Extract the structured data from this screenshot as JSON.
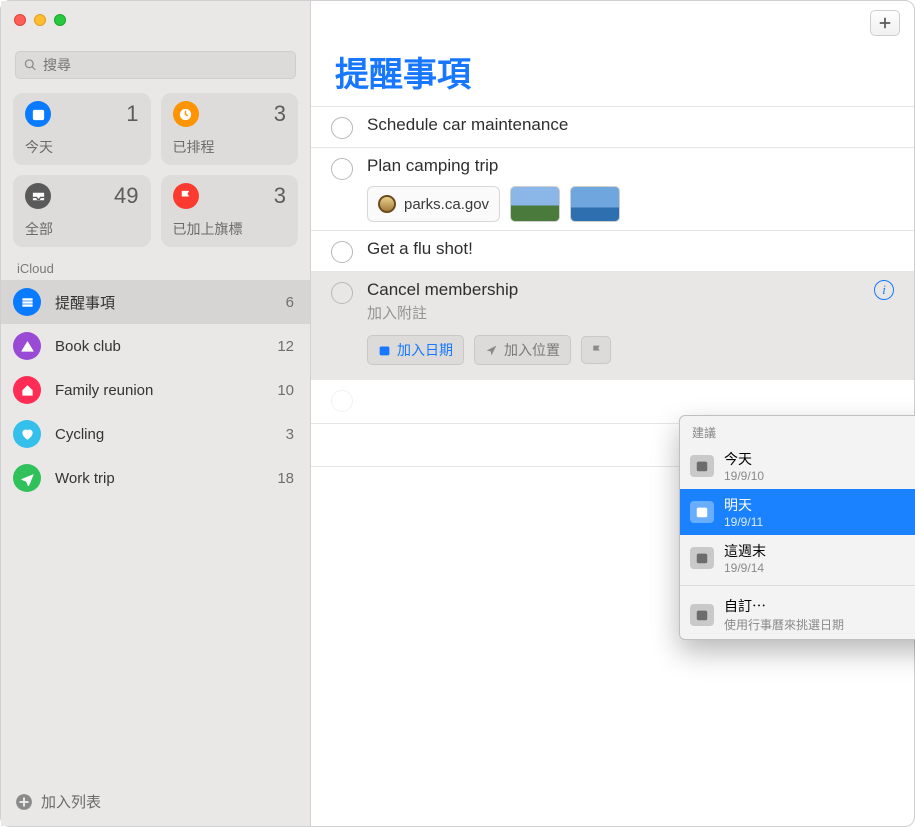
{
  "traffic_lights": {
    "close": "close",
    "minimize": "minimize",
    "zoom": "zoom"
  },
  "search": {
    "placeholder": "搜尋"
  },
  "smart_lists": {
    "today": {
      "label": "今天",
      "count": "1"
    },
    "scheduled": {
      "label": "已排程",
      "count": "3"
    },
    "all": {
      "label": "全部",
      "count": "49"
    },
    "flagged": {
      "label": "已加上旗標",
      "count": "3"
    }
  },
  "section_label": "iCloud",
  "lists": [
    {
      "name": "提醒事項",
      "count": "6",
      "color": "#0a7bff",
      "icon": "list",
      "active": true
    },
    {
      "name": "Book club",
      "count": "12",
      "color": "#9a4bd6",
      "icon": "tent",
      "active": false
    },
    {
      "name": "Family reunion",
      "count": "10",
      "color": "#ff2d55",
      "icon": "house",
      "active": false
    },
    {
      "name": "Cycling",
      "count": "3",
      "color": "#34c0eb",
      "icon": "heart",
      "active": false
    },
    {
      "name": "Work trip",
      "count": "18",
      "color": "#30c15b",
      "icon": "plane",
      "active": false
    }
  ],
  "add_list_label": "加入列表",
  "main": {
    "title": "提醒事項",
    "reminders": [
      {
        "title": "Schedule car maintenance"
      },
      {
        "title": "Plan camping trip",
        "link": "parks.ca.gov"
      },
      {
        "title": "Get a flu shot!"
      },
      {
        "title": "Cancel membership",
        "editing": true
      }
    ],
    "editing_fields": {
      "notes_placeholder": "加入附註",
      "date_label": "加入日期",
      "location_label": "加入位置"
    }
  },
  "popover": {
    "header": "建議",
    "items": [
      {
        "main": "今天",
        "sub": "19/9/10",
        "selected": false
      },
      {
        "main": "明天",
        "sub": "19/9/11",
        "selected": true
      },
      {
        "main": "這週末",
        "sub": "19/9/14",
        "selected": false
      }
    ],
    "custom": {
      "main": "自訂⋯",
      "sub": "使用行事曆來挑選日期"
    }
  }
}
